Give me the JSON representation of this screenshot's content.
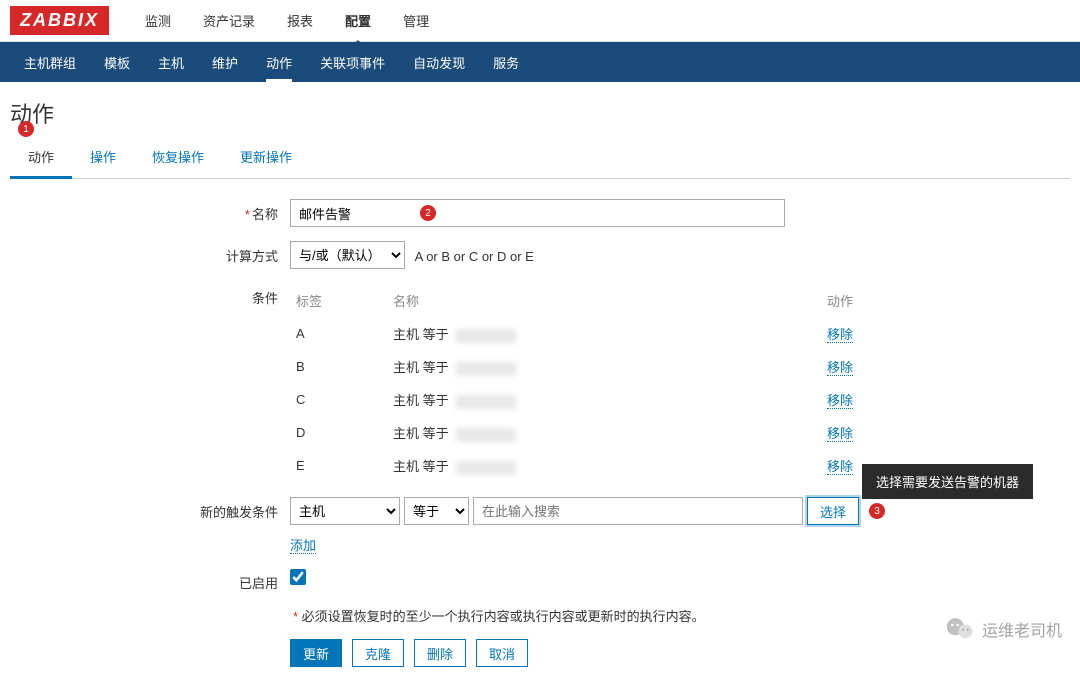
{
  "logo": "ZABBIX",
  "topnav": {
    "items": [
      "监测",
      "资产记录",
      "报表",
      "配置",
      "管理"
    ],
    "active": 3
  },
  "subnav": {
    "items": [
      "主机群组",
      "模板",
      "主机",
      "维护",
      "动作",
      "关联项事件",
      "自动发现",
      "服务"
    ],
    "active": 4
  },
  "page": {
    "title": "动作"
  },
  "tabs": {
    "items": [
      "动作",
      "操作",
      "恢复操作",
      "更新操作"
    ],
    "active": 0
  },
  "badges": {
    "b1": "1",
    "b2": "2",
    "b3": "3"
  },
  "form": {
    "name": {
      "label": "名称",
      "value": "邮件告警"
    },
    "calc": {
      "label": "计算方式",
      "selected": "与/或（默认）",
      "expr": "A or B or C or D or E"
    },
    "conditions": {
      "label": "条件",
      "headers": {
        "tag": "标签",
        "name": "名称",
        "action": "动作"
      },
      "rows": [
        {
          "tag": "A",
          "name": "主机 等于",
          "action": "移除"
        },
        {
          "tag": "B",
          "name": "主机 等于",
          "action": "移除"
        },
        {
          "tag": "C",
          "name": "主机 等于",
          "action": "移除"
        },
        {
          "tag": "D",
          "name": "主机 等于",
          "action": "移除"
        },
        {
          "tag": "E",
          "name": "主机 等于",
          "action": "移除"
        }
      ]
    },
    "newcond": {
      "label": "新的触发条件",
      "type": "主机",
      "op": "等于",
      "search_ph": "在此输入搜索",
      "select_btn": "选择",
      "add_link": "添加"
    },
    "enabled": {
      "label": "已启用",
      "checked": true
    },
    "warning": "必须设置恢复时的至少一个执行内容或执行内容或更新时的执行内容。",
    "buttons": {
      "update": "更新",
      "clone": "克隆",
      "delete": "删除",
      "cancel": "取消"
    }
  },
  "tooltip": "选择需要发送告警的机器",
  "watermark": "运维老司机"
}
